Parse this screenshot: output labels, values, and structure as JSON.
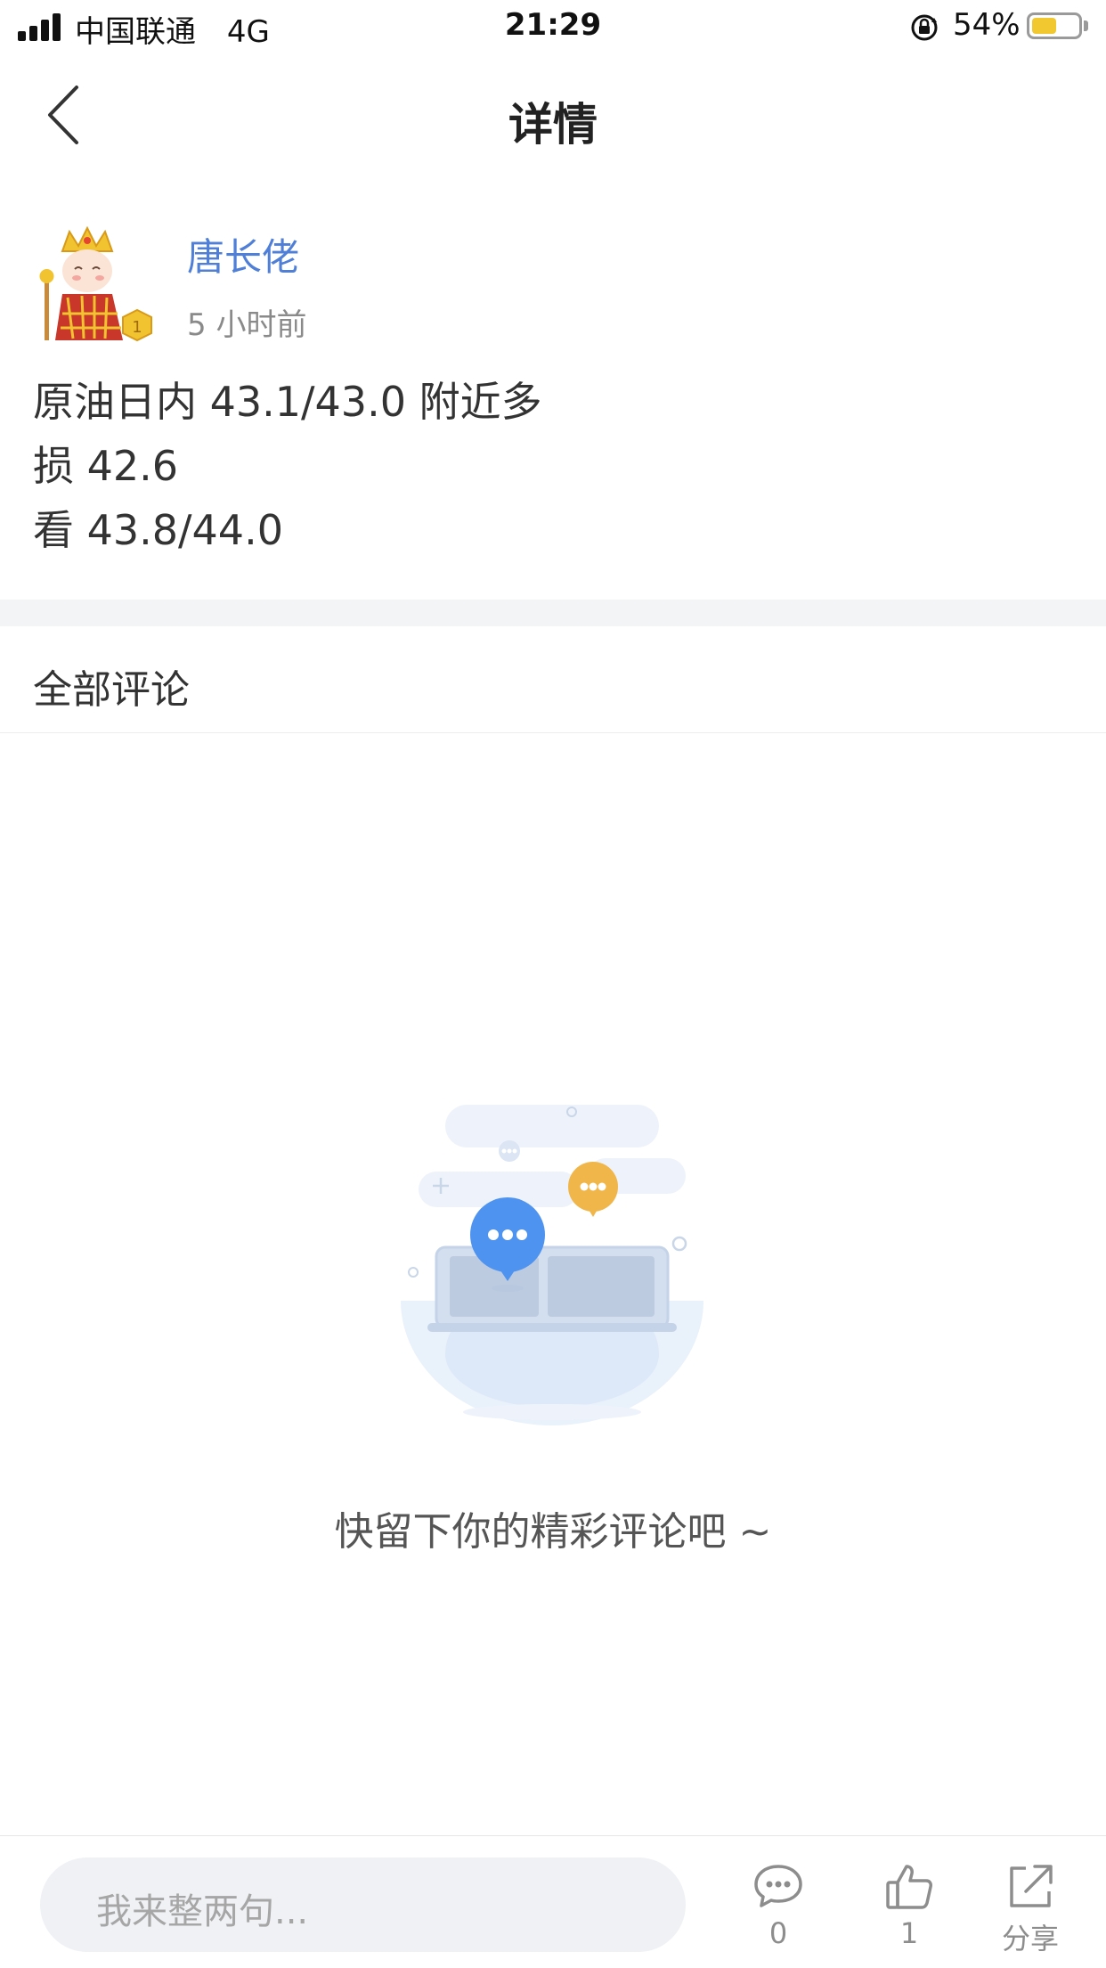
{
  "status_bar": {
    "carrier": "中国联通",
    "network": "4G",
    "time": "21:29",
    "battery": "54%",
    "battery_level": 0.54,
    "battery_color": "#f2c831"
  },
  "nav": {
    "title": "详情",
    "back_icon": "chevron-left-icon"
  },
  "post": {
    "author": "唐长佬",
    "time_ago": "5 小时前",
    "badge_level": "1",
    "lines": [
      "原油日内 43.1/43.0 附近多",
      "损 42.6",
      "看 43.8/44.0"
    ]
  },
  "comments": {
    "title": "全部评论",
    "empty_text": "快留下你的精彩评论吧 ~"
  },
  "bottom_bar": {
    "input_placeholder": "我来整两句...",
    "comment_count": "0",
    "like_count": "1",
    "share_label": "分享"
  },
  "colors": {
    "author_link": "#4f7fd6",
    "bubble_blue": "#4e93f0",
    "bubble_orange": "#f0b64a"
  }
}
